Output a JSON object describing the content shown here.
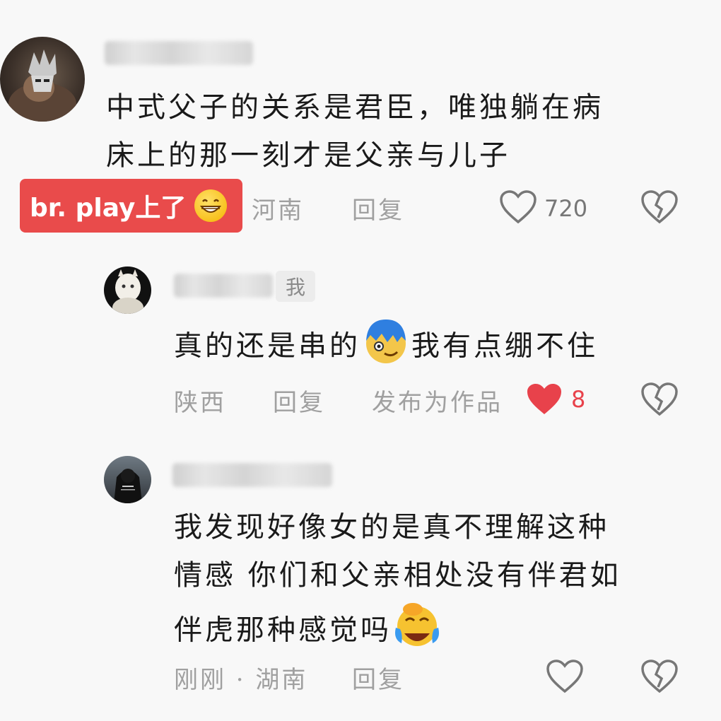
{
  "comments": [
    {
      "text_line1": "中式父子的关系是君臣，唯独躺在病",
      "text_line2": "床上的那一刻才是父亲与儿子",
      "location": "河南",
      "reply_label": "回复",
      "like_count": "720"
    },
    {
      "me_tag": "我",
      "text_before_emoji": "真的还是串的",
      "text_after_emoji": "我有点绷不住",
      "location": "陕西",
      "reply_label": "回复",
      "publish_label": "发布为作品",
      "like_count": "8"
    },
    {
      "text_line1": "我发现好像女的是真不理解这种",
      "text_line2": "情感 你们和父亲相处没有伴君如",
      "text_line3": "伴虎那种感觉吗",
      "time_location": "刚刚 · 湖南",
      "reply_label": "回复"
    }
  ],
  "badge": {
    "text": "br. play上了"
  },
  "colors": {
    "badge_bg": "#e94b4b",
    "liked_heart": "#e8424b",
    "meta_text": "#a0a0a0"
  },
  "icons": [
    "heart-outline-icon",
    "broken-heart-icon",
    "heart-filled-icon",
    "grin-emoji",
    "laugh-cry-emoji"
  ]
}
